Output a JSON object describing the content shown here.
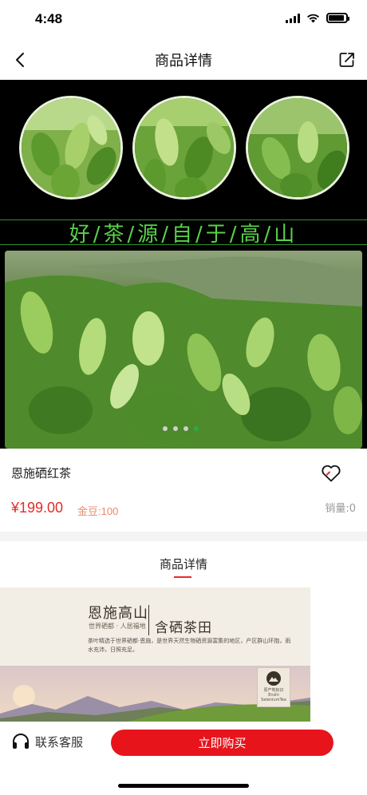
{
  "status_bar": {
    "time": "4:48",
    "battery_level": 0.9,
    "icons": [
      "signal-icon",
      "wifi-icon",
      "battery-icon"
    ]
  },
  "nav": {
    "title": "商品详情",
    "back_icon": "chevron-left-icon",
    "share_icon": "share-icon"
  },
  "banner": {
    "slogan": "好/茶/源/自/于/高/山"
  },
  "gallery": {
    "page_count": 4,
    "active_index": 3
  },
  "product": {
    "name": "恩施硒红茶",
    "price": "¥199.00",
    "beans": "金豆:100",
    "sales": "销量:0",
    "favorite_icon": "heart-icon"
  },
  "detail": {
    "tab_label": "商品详情",
    "poster": {
      "heading": "恩施高山",
      "sub": "世界硒都 · 人居福地",
      "heading2": "含硒茶田",
      "text": "茶叶精选于世界硒都·恩施，是世界天然生物硒资源富集的地区，产区群山环抱，雨水充沛，日照充足。",
      "badge": "原产地标识 Enshi SeleniumTea"
    }
  },
  "bottom_bar": {
    "service_label": "联系客服",
    "service_icon": "headset-icon",
    "buy_label": "立即购买"
  },
  "colors": {
    "accent_red": "#e8141c",
    "price_red": "#e52b2b",
    "slogan_green": "#59d14a",
    "pager_active": "#2ea94b"
  }
}
